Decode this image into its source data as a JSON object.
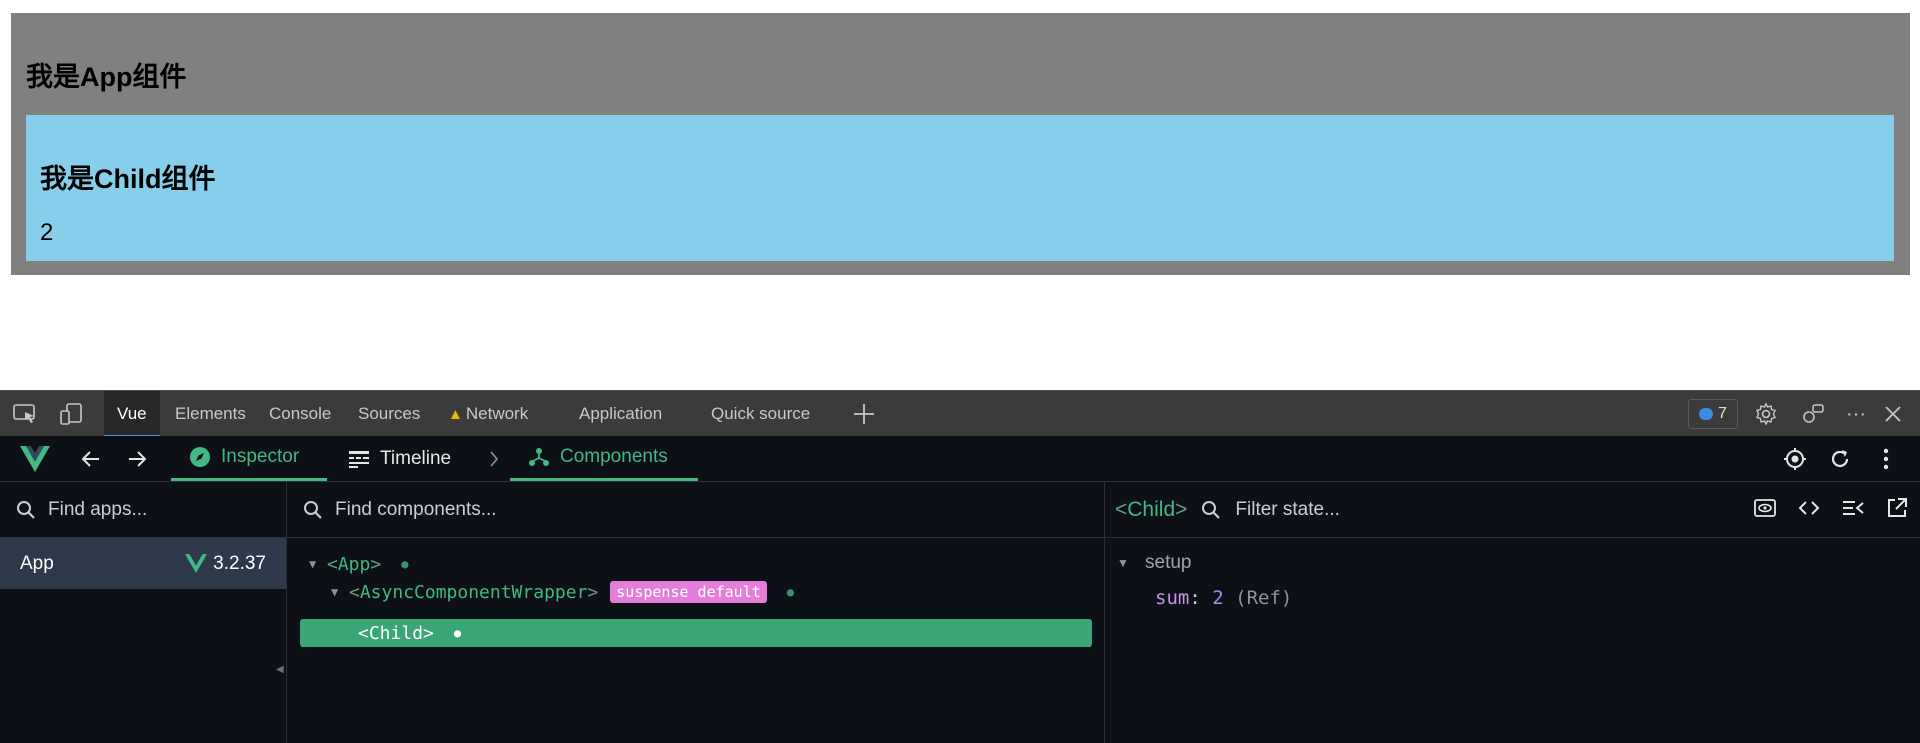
{
  "page": {
    "app_heading": "我是App组件",
    "child_heading": "我是Child组件",
    "sum_value": "2"
  },
  "devtools": {
    "tabs": [
      "Vue",
      "Elements",
      "Console",
      "Sources",
      "Network",
      "Application",
      "Quick source"
    ],
    "active_tab": "Vue",
    "issues_count": "7"
  },
  "vue_toolbar": {
    "inspector_label": "Inspector",
    "timeline_label": "Timeline",
    "components_label": "Components"
  },
  "apps_pane": {
    "search_placeholder": "Find apps...",
    "app_name": "App",
    "vue_version": "3.2.37"
  },
  "components_pane": {
    "search_placeholder": "Find components...",
    "tree": [
      {
        "name": "App",
        "expanded": true
      },
      {
        "name": "AsyncComponentWrapper",
        "badge": "suspense default",
        "expanded": true
      },
      {
        "name": "Child",
        "selected": true
      }
    ]
  },
  "state_pane": {
    "component": "Child",
    "filter_placeholder": "Filter state...",
    "section": "setup",
    "state": [
      {
        "key": "sum",
        "value": "2",
        "type": "(Ref)"
      }
    ]
  },
  "colors": {
    "vue_green": "#42b883",
    "selected_row": "#3aa675",
    "badge_pink": "#e47fd9",
    "app_box_gray": "#808080",
    "child_box_blue": "#87ceeb"
  }
}
